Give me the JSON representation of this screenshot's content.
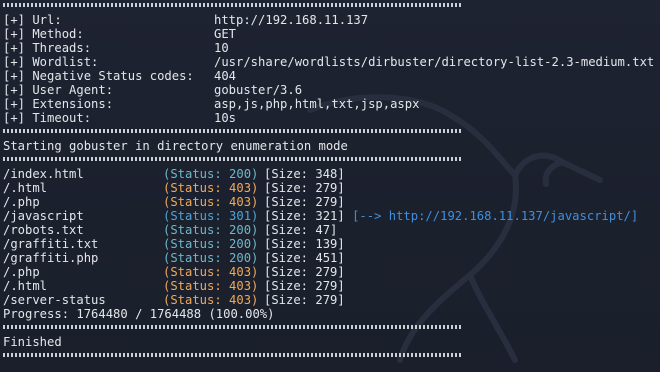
{
  "config": [
    {
      "key": "[+] Url:",
      "value": "http://192.168.11.137"
    },
    {
      "key": "[+] Method:",
      "value": "GET"
    },
    {
      "key": "[+] Threads:",
      "value": "10"
    },
    {
      "key": "[+] Wordlist:",
      "value": "/usr/share/wordlists/dirbuster/directory-list-2.3-medium.txt"
    },
    {
      "key": "[+] Negative Status codes:",
      "value": "404"
    },
    {
      "key": "[+] User Agent:",
      "value": "gobuster/3.6"
    },
    {
      "key": "[+] Extensions:",
      "value": "asp,js,php,html,txt,jsp,aspx"
    },
    {
      "key": "[+] Timeout:",
      "value": "10s"
    }
  ],
  "start_message": "Starting gobuster in directory enumeration mode",
  "results": [
    {
      "path": "/index.html",
      "status": "(Status: 200)",
      "code": "200",
      "size": "[Size: 348]",
      "redirect": ""
    },
    {
      "path": "/.html",
      "status": "(Status: 403)",
      "code": "403",
      "size": "[Size: 279]",
      "redirect": ""
    },
    {
      "path": "/.php",
      "status": "(Status: 403)",
      "code": "403",
      "size": "[Size: 279]",
      "redirect": ""
    },
    {
      "path": "/javascript",
      "status": "(Status: 301)",
      "code": "301",
      "size": "[Size: 321]",
      "redirect": "[--> http://192.168.11.137/javascript/]"
    },
    {
      "path": "/robots.txt",
      "status": "(Status: 200)",
      "code": "200",
      "size": "[Size: 47]",
      "redirect": ""
    },
    {
      "path": "/graffiti.txt",
      "status": "(Status: 200)",
      "code": "200",
      "size": "[Size: 139]",
      "redirect": ""
    },
    {
      "path": "/graffiti.php",
      "status": "(Status: 200)",
      "code": "200",
      "size": "[Size: 451]",
      "redirect": ""
    },
    {
      "path": "/.php",
      "status": "(Status: 403)",
      "code": "403",
      "size": "[Size: 279]",
      "redirect": ""
    },
    {
      "path": "/.html",
      "status": "(Status: 403)",
      "code": "403",
      "size": "[Size: 279]",
      "redirect": ""
    },
    {
      "path": "/server-status",
      "status": "(Status: 403)",
      "code": "403",
      "size": "[Size: 279]",
      "redirect": ""
    }
  ],
  "progress": "Progress: 1764480 / 1764488 (100.00%)",
  "finish_message": "Finished",
  "colors": {
    "status_200": "#6fb7c8",
    "status_403": "#f0a95b",
    "status_301": "#4fa4d8",
    "redirect": "#3f8fe0"
  },
  "background_icon": "kali-dragon-icon"
}
